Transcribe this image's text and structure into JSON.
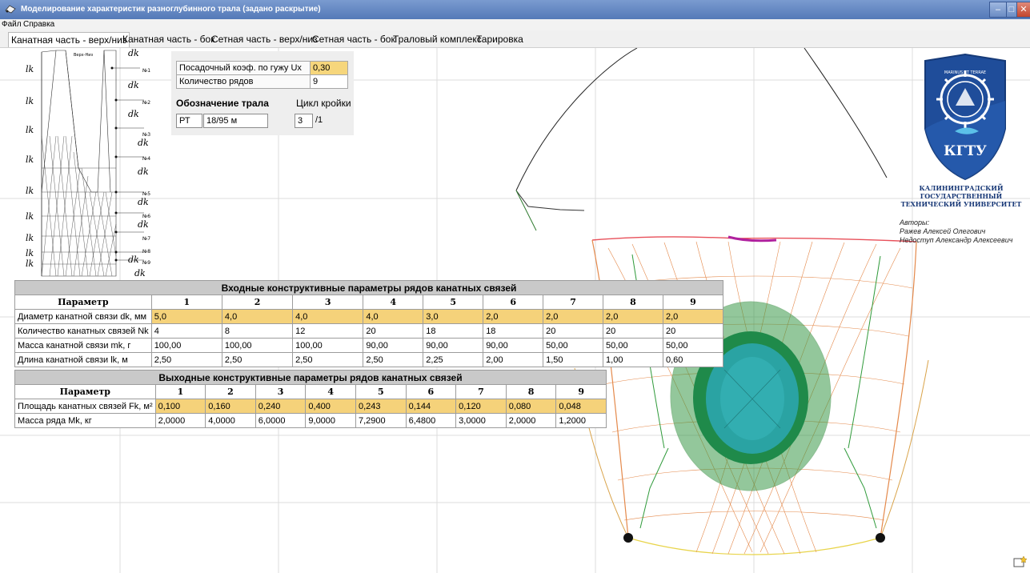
{
  "window": {
    "title": "Моделирование характеристик разноглубинного трала (задано раскрытие)"
  },
  "menu": [
    "Файл",
    "Справка"
  ],
  "tabs": [
    {
      "label": "Канатная часть - верх/низ",
      "active": true
    },
    {
      "label": "Канатная часть - бок"
    },
    {
      "label": "Сетная часть - верх/низ"
    },
    {
      "label": "Сетная часть - бок"
    },
    {
      "label": "Траловый комплекс"
    },
    {
      "label": "Тарировка"
    }
  ],
  "diagram": {
    "title": "Верх-Низ",
    "left_labels": [
      "lk",
      "lk",
      "lk",
      "lk",
      "lk",
      "lk",
      "lk",
      "lk",
      "lk"
    ],
    "right_labels": [
      "№1",
      "№2",
      "№3",
      "№4",
      "№5",
      "№6",
      "№7",
      "№8",
      "№9"
    ],
    "dk_label": "dk"
  },
  "params": {
    "coef_label": "Посадочный коэф. по гужу Ux",
    "coef_value": "0,30",
    "rows_label": "Количество рядов",
    "rows_value": "9",
    "trawl_title": "Обозначение трала",
    "trawl_code": "РТ",
    "trawl_size": "18/95 м",
    "cycle_title": "Цикл кройки",
    "cycle_value": "3",
    "cycle_suffix": "/1"
  },
  "input_table": {
    "title": "Входные конструктивные параметры рядов канатных связей",
    "param_header": "Параметр",
    "columns": [
      "1",
      "2",
      "3",
      "4",
      "5",
      "6",
      "7",
      "8",
      "9"
    ],
    "rows": [
      {
        "label": "Диаметр канатной связи dk, мм",
        "highlight": true,
        "values": [
          "5,0",
          "4,0",
          "4,0",
          "4,0",
          "3,0",
          "2,0",
          "2,0",
          "2,0",
          "2,0"
        ]
      },
      {
        "label": "Количество канатных связей Nk",
        "highlight": false,
        "values": [
          "4",
          "8",
          "12",
          "20",
          "18",
          "18",
          "20",
          "20",
          "20"
        ]
      },
      {
        "label": "Масса канатной связи mk, г",
        "highlight": false,
        "values": [
          "100,00",
          "100,00",
          "100,00",
          "90,00",
          "90,00",
          "90,00",
          "50,00",
          "50,00",
          "50,00"
        ]
      },
      {
        "label": "Длина канатной связи lk, м",
        "highlight": false,
        "values": [
          "2,50",
          "2,50",
          "2,50",
          "2,50",
          "2,25",
          "2,00",
          "1,50",
          "1,00",
          "0,60"
        ]
      }
    ]
  },
  "output_table": {
    "title": "Выходные конструктивные параметры рядов канатных связей",
    "param_header": "Параметр",
    "columns": [
      "1",
      "2",
      "3",
      "4",
      "5",
      "6",
      "7",
      "8",
      "9"
    ],
    "rows": [
      {
        "label": "Площадь канатных связей Fk, м²",
        "highlight": true,
        "values": [
          "0,100",
          "0,160",
          "0,240",
          "0,400",
          "0,243",
          "0,144",
          "0,120",
          "0,080",
          "0,048"
        ]
      },
      {
        "label": "Масса ряда Mk, кг",
        "highlight": false,
        "values": [
          "2,0000",
          "4,0000",
          "6,0000",
          "9,0000",
          "7,2900",
          "6,4800",
          "3,0000",
          "2,0000",
          "1,2000"
        ]
      }
    ]
  },
  "logo": {
    "ring_text": "MARINUS ET TERRAE",
    "abbr": "КГТУ",
    "univ_lines": [
      "КАЛИНИНГРАДСКИЙ",
      "ГОСУДАРСТВЕННЫЙ",
      "ТЕХНИЧЕСКИЙ УНИВЕРСИТЕТ"
    ]
  },
  "authors": {
    "heading": "Авторы:",
    "names": [
      "Ражев Алексей Олегович",
      "Недоступ Александр Алексеевич"
    ]
  },
  "colors": {
    "highlight": "#f6d67c",
    "header_gray": "#c9c9c9",
    "net_orange": "#e4894b",
    "net_green": "#2f9a3a",
    "net_red": "#e8505a",
    "logo_blue": "#1f4d9a"
  }
}
